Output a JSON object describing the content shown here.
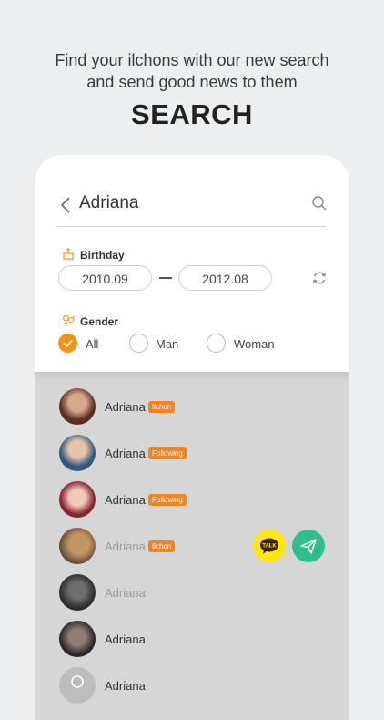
{
  "promo": {
    "line1": "Find your ilchons with our new search",
    "line2": "and send good news to them",
    "headline": "SEARCH"
  },
  "search": {
    "query": "Adriana",
    "icons": {
      "back": "chevron-left-icon",
      "search": "magnifier-icon"
    }
  },
  "birthday": {
    "label": "Birthday",
    "icon": "cake-icon",
    "from": "2010.09",
    "to": "2012.08",
    "refresh_icon": "refresh-icon"
  },
  "gender": {
    "label": "Gender",
    "icon": "gender-icon",
    "options": [
      {
        "label": "All",
        "selected": true
      },
      {
        "label": "Man",
        "selected": false
      },
      {
        "label": "Woman",
        "selected": false
      }
    ]
  },
  "results": [
    {
      "name": "Adriana",
      "badge": "Ilchon",
      "dimmed": false,
      "avatar_color": "#8a4b3a"
    },
    {
      "name": "Adriana",
      "badge": "Following",
      "dimmed": false,
      "avatar_color": "#3f6f9a"
    },
    {
      "name": "Adriana",
      "badge": "Following",
      "dimmed": false,
      "avatar_color": "#9a2f3c"
    },
    {
      "name": "Adriana",
      "badge": "Ilchon",
      "dimmed": true,
      "avatar_color": "#a87e4e"
    },
    {
      "name": "Adriana",
      "badge": "",
      "dimmed": true,
      "avatar_color": "#4a4a4a"
    },
    {
      "name": "Adriana",
      "badge": "",
      "dimmed": false,
      "avatar_color": "#3c3633"
    },
    {
      "name": "Adriana",
      "badge": "",
      "dimmed": false,
      "avatar_color": "#ffffff"
    }
  ],
  "actions": {
    "talk_label": "TALK",
    "talk_color": "#ffe812",
    "send_color": "#2ebf8a"
  },
  "colors": {
    "accent": "#f39314",
    "badge": "#f08420"
  }
}
